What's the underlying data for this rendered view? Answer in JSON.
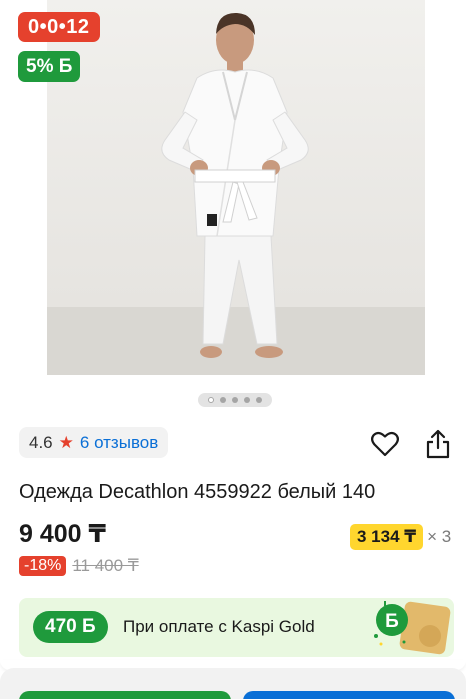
{
  "product_image": {
    "subject": "karate-kimono-photo"
  },
  "badges": {
    "timer": "0•0•12",
    "bonus": "5% Б"
  },
  "carousel": {
    "dots": 5,
    "active": 0
  },
  "rating": {
    "value": "4.6",
    "reviews_label": "6 отзывов"
  },
  "icons": {
    "star": "star-icon",
    "favorite": "heart-icon",
    "share": "share-icon"
  },
  "product": {
    "title": "Одежда Decathlon 4559922 белый 140",
    "price": "9 400 ₸",
    "installment_amount": "3 134 ₸",
    "installment_times": "× 3",
    "discount": "-18%",
    "old_price": "11 400 ₸"
  },
  "kaspi": {
    "bonus": "470 Б",
    "text": "При оплате с Kaspi Gold"
  },
  "colors": {
    "red": "#e5412d",
    "green": "#1f9a3c",
    "blue": "#0a6fd6",
    "yellow": "#ffd62e",
    "panel_green": "#e9f8e0"
  }
}
